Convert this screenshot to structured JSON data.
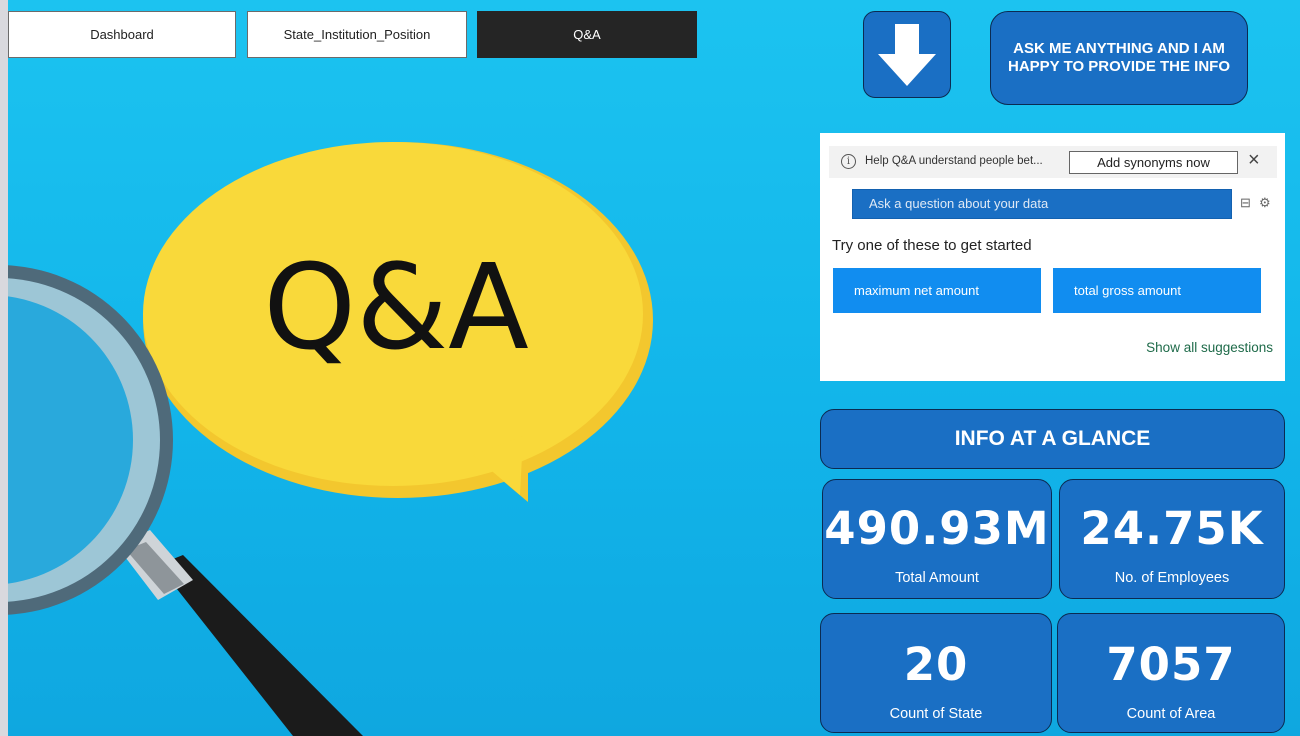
{
  "nav": {
    "tabs": [
      {
        "label": "Dashboard"
      },
      {
        "label": "State_Institution_Position"
      },
      {
        "label": "Q&A"
      }
    ]
  },
  "hero": {
    "bubble_text": "Q&A"
  },
  "header_right": {
    "arrow_icon": "arrow-down-icon",
    "ask_label": "ASK ME ANYTHING AND I AM HAPPY TO PROVIDE THE INFO"
  },
  "qa": {
    "help_text": "Help Q&A understand people bet...",
    "synonyms_label": "Add synonyms now",
    "close_icon": "×",
    "input_placeholder": "Ask a question about your data",
    "try_text": "Try one of these to get started",
    "suggestions": [
      {
        "label": "maximum net amount"
      },
      {
        "label": "total gross amount"
      }
    ],
    "show_all": "Show all suggestions"
  },
  "glance": {
    "title": "INFO AT A GLANCE",
    "cards": [
      {
        "value": "490.93M",
        "label": "Total Amount"
      },
      {
        "value": "24.75K",
        "label": "No. of Employees"
      },
      {
        "value": "20",
        "label": "Count of State"
      },
      {
        "value": "7057",
        "label": "Count of Area"
      }
    ]
  },
  "colors": {
    "background": "#12b5ea",
    "card": "#1a6fc4",
    "suggestion": "#118df0",
    "bubble": "#f9d93a"
  }
}
